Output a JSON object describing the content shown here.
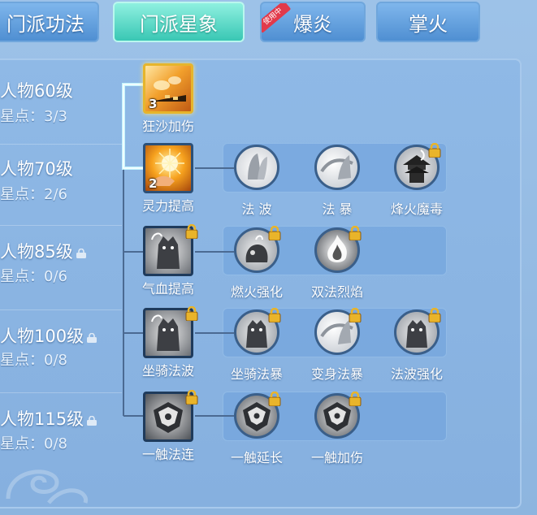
{
  "tabs": [
    {
      "label": "门派功法",
      "active": false
    },
    {
      "label": "门派星象",
      "active": true
    },
    {
      "label": "爆炎",
      "active": false,
      "badge": "使用中"
    },
    {
      "label": "掌火",
      "active": false
    }
  ],
  "levels": [
    {
      "title": "人物60级",
      "stars": "星点：3/3",
      "locked": false
    },
    {
      "title": "人物70级",
      "stars": "星点：2/6",
      "locked": false
    },
    {
      "title": "人物85级",
      "stars": "星点：0/6",
      "locked": true
    },
    {
      "title": "人物100级",
      "stars": "星点：0/8",
      "locked": true
    },
    {
      "title": "人物115级",
      "stars": "星点：0/8",
      "locked": true
    }
  ],
  "skills": {
    "r1": [
      {
        "label": "狂沙加伤",
        "count": "3",
        "locked": false,
        "icon": "sandstorm-icon"
      }
    ],
    "r2": [
      {
        "label": "灵力提高",
        "count": "2",
        "locked": false,
        "icon": "spirit-hand-icon"
      },
      {
        "label": "法 波",
        "locked": false,
        "icon": "magic-wave-icon"
      },
      {
        "label": "法 暴",
        "locked": false,
        "icon": "magic-crit-icon"
      },
      {
        "label": "烽火魔毒",
        "locked": true,
        "icon": "beacon-poison-icon"
      }
    ],
    "r3": [
      {
        "label": "气血提高",
        "locked": true,
        "icon": "vitality-icon"
      },
      {
        "label": "燃火强化",
        "locked": true,
        "icon": "ignite-icon"
      },
      {
        "label": "双法烈焰",
        "locked": true,
        "icon": "twin-flame-icon"
      }
    ],
    "r4": [
      {
        "label": "坐骑法波",
        "locked": true,
        "icon": "mount-wave-icon"
      },
      {
        "label": "坐骑法暴",
        "locked": true,
        "icon": "mount-crit-icon"
      },
      {
        "label": "变身法暴",
        "locked": true,
        "icon": "transform-crit-icon"
      },
      {
        "label": "法波强化",
        "locked": true,
        "icon": "wave-boost-icon"
      }
    ],
    "r5": [
      {
        "label": "一触法连",
        "locked": true,
        "icon": "touch-combo-icon"
      },
      {
        "label": "一触延长",
        "locked": true,
        "icon": "touch-extend-icon"
      },
      {
        "label": "一触加伤",
        "locked": true,
        "icon": "touch-damage-icon"
      }
    ]
  },
  "colors": {
    "active_tab": "#39c7b4",
    "tab": "#4f8fd2",
    "panel": "#8fb9e6",
    "badge": "#e23a4b"
  }
}
